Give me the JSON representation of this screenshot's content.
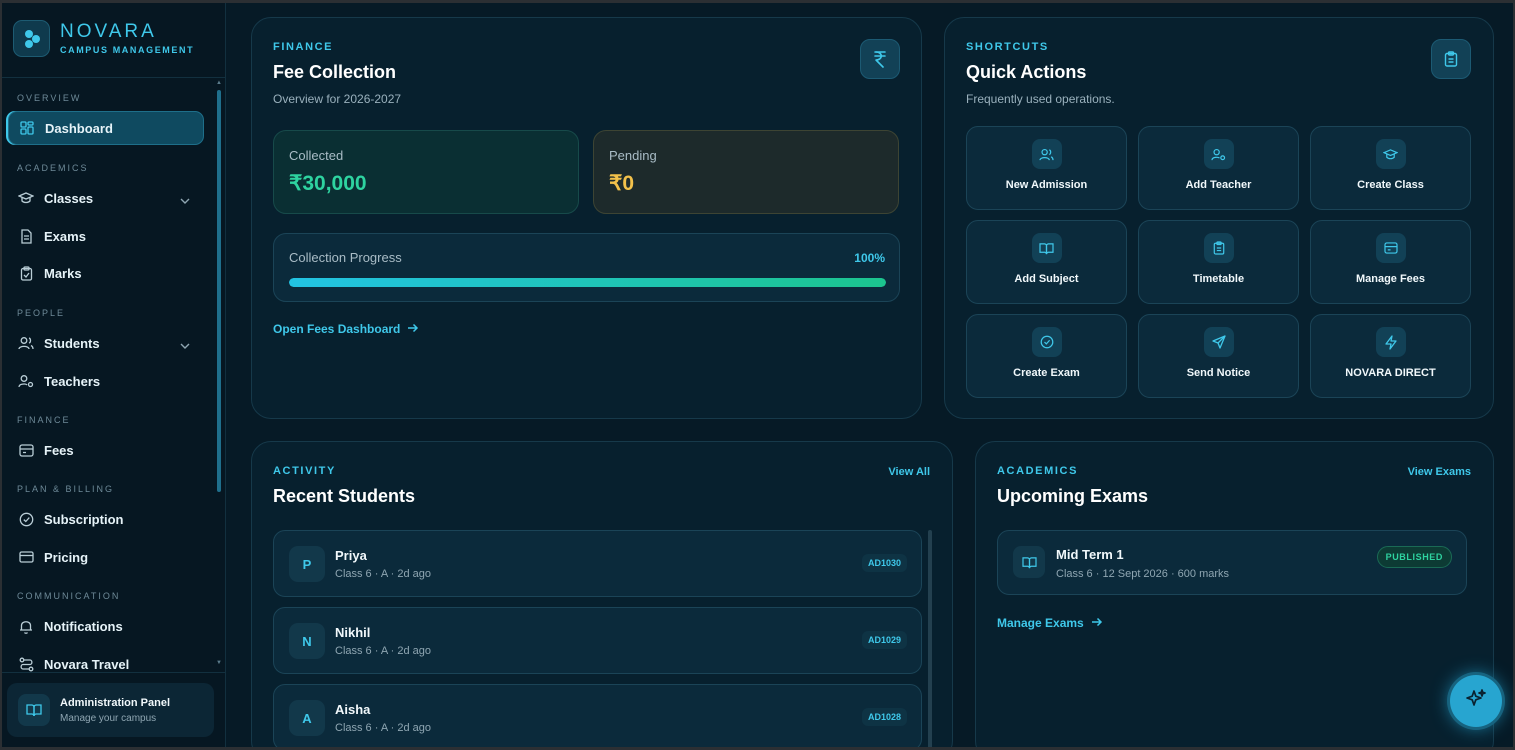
{
  "brand": {
    "name": "NOVARA",
    "subtitle": "CAMPUS MANAGEMENT"
  },
  "sidebar": {
    "sections": [
      {
        "title": "OVERVIEW"
      },
      {
        "title": "ACADEMICS"
      },
      {
        "title": "PEOPLE"
      },
      {
        "title": "FINANCE"
      },
      {
        "title": "PLAN & BILLING"
      },
      {
        "title": "COMMUNICATION"
      }
    ],
    "items": [
      {
        "label": "Dashboard",
        "icon": "grid-icon",
        "active": true
      },
      {
        "label": "Classes",
        "icon": "graduation-cap-icon",
        "expandable": true
      },
      {
        "label": "Exams",
        "icon": "document-icon"
      },
      {
        "label": "Marks",
        "icon": "clipboard-check-icon"
      },
      {
        "label": "Students",
        "icon": "users-icon",
        "expandable": true
      },
      {
        "label": "Teachers",
        "icon": "user-gear-icon"
      },
      {
        "label": "Fees",
        "icon": "wallet-icon"
      },
      {
        "label": "Subscription",
        "icon": "check-circle-icon"
      },
      {
        "label": "Pricing",
        "icon": "credit-card-icon"
      },
      {
        "label": "Notifications",
        "icon": "bell-icon"
      },
      {
        "label": "Novara Travel",
        "icon": "route-icon"
      }
    ],
    "admin": {
      "title": "Administration Panel",
      "subtitle": "Manage your campus"
    }
  },
  "fee_collection": {
    "eyebrow": "FINANCE",
    "title": "Fee Collection",
    "subtitle": "Overview for 2026-2027",
    "icon": "rupee-icon",
    "collected": {
      "label": "Collected",
      "value": "₹30,000"
    },
    "pending": {
      "label": "Pending",
      "value": "₹0"
    },
    "progress": {
      "label": "Collection Progress",
      "percent_text": "100%",
      "value": 1.0
    },
    "link": "Open Fees Dashboard"
  },
  "quick_actions": {
    "eyebrow": "SHORTCUTS",
    "title": "Quick Actions",
    "subtitle": "Frequently used operations.",
    "icon": "clipboard-icon",
    "actions": [
      {
        "label": "New Admission",
        "icon": "users-icon"
      },
      {
        "label": "Add Teacher",
        "icon": "user-gear-icon"
      },
      {
        "label": "Create Class",
        "icon": "graduation-cap-icon"
      },
      {
        "label": "Add Subject",
        "icon": "book-icon"
      },
      {
        "label": "Timetable",
        "icon": "clipboard-icon"
      },
      {
        "label": "Manage Fees",
        "icon": "wallet-icon"
      },
      {
        "label": "Create Exam",
        "icon": "check-circle-icon"
      },
      {
        "label": "Send Notice",
        "icon": "send-icon"
      },
      {
        "label": "NOVARA DIRECT",
        "icon": "lightning-icon"
      }
    ]
  },
  "recent_students": {
    "eyebrow": "ACTIVITY",
    "title": "Recent Students",
    "view_all": "View All",
    "students": [
      {
        "initial": "P",
        "name": "Priya",
        "meta": "Class 6 · A · 2d ago",
        "id": "AD1030"
      },
      {
        "initial": "N",
        "name": "Nikhil",
        "meta": "Class 6 · A · 2d ago",
        "id": "AD1029"
      },
      {
        "initial": "A",
        "name": "Aisha",
        "meta": "Class 6 · A · 2d ago",
        "id": "AD1028"
      }
    ]
  },
  "upcoming_exams": {
    "eyebrow": "ACADEMICS",
    "title": "Upcoming Exams",
    "view_link": "View Exams",
    "exams": [
      {
        "name": "Mid Term 1",
        "meta": "Class 6 · 12 Sept 2026 · 600 marks",
        "status": "PUBLISHED"
      }
    ],
    "manage_link": "Manage Exams"
  },
  "colors": {
    "accent": "#3fc8ea",
    "collected": "#2ed3a0",
    "pending": "#f2c14b",
    "background": "#061a26"
  }
}
